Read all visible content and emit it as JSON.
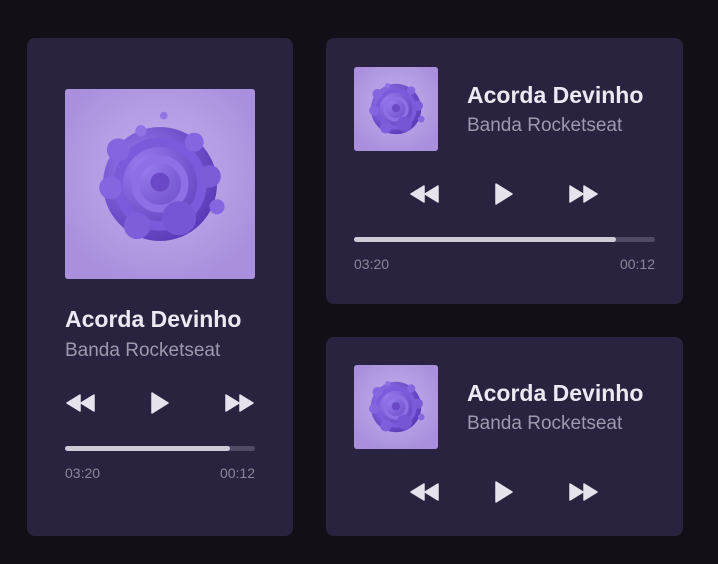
{
  "colors": {
    "background": "#121016",
    "card": "#2a2340",
    "cover_bg": "#b299e2",
    "title": "#ece9f3",
    "artist": "#9f98ae",
    "progress_track": "#514a65",
    "progress_fill": "#cfcbd6"
  },
  "players": [
    {
      "title": "Acorda Devinho",
      "artist": "Banda Rocketseat",
      "elapsed": "03:20",
      "remaining": "00:12",
      "progress": 0.87,
      "controls": {
        "prev_icon": "rewind-icon",
        "play_icon": "play-icon",
        "next_icon": "fast-forward-icon"
      }
    },
    {
      "title": "Acorda Devinho",
      "artist": "Banda Rocketseat",
      "elapsed": "03:20",
      "remaining": "00:12",
      "progress": 0.87,
      "controls": {
        "prev_icon": "rewind-icon",
        "play_icon": "play-icon",
        "next_icon": "fast-forward-icon"
      }
    },
    {
      "title": "Acorda Devinho",
      "artist": "Banda Rocketseat",
      "controls": {
        "prev_icon": "rewind-icon",
        "play_icon": "play-icon",
        "next_icon": "fast-forward-icon"
      }
    }
  ]
}
